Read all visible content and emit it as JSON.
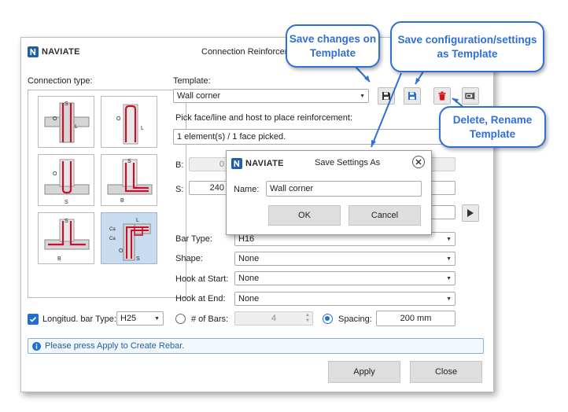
{
  "dialog": {
    "brand": "NAVIATE",
    "title": "Connection Reinforceme",
    "connection_type_label": "Connection type:",
    "template_label": "Template:",
    "template_value": "Wall corner",
    "pick_instruction": "Pick face/line and host to place reinforcement:",
    "pick_status": "1 element(s) / 1 face picked.",
    "b_label": "B:",
    "b_value": "0",
    "s_label": "S:",
    "s_value": "240",
    "bar_type_label": "Bar Type:",
    "bar_type_value": "H16",
    "shape_label": "Shape:",
    "shape_value": "None",
    "hook_start_label": "Hook at Start:",
    "hook_start_value": "None",
    "hook_end_label": "Hook at End:",
    "hook_end_value": "None",
    "long_bar_label": "Longitud. bar Type:",
    "long_bar_value": "H25",
    "long_bar_checked": true,
    "num_bars_label": "# of Bars:",
    "num_bars_value": "4",
    "spacing_label": "Spacing:",
    "spacing_value": "200 mm",
    "info_message": "Please press Apply to Create Rebar.",
    "apply_label": "Apply",
    "close_label": "Close"
  },
  "tiles": [
    {
      "name": "t-junction-straight",
      "labels": [
        "S",
        "O",
        "L"
      ]
    },
    {
      "name": "u-bar-top",
      "labels": [
        "O",
        "L"
      ]
    },
    {
      "name": "u-bar-bottom",
      "labels": [
        "O",
        "S"
      ]
    },
    {
      "name": "l-bar-corner",
      "labels": [
        "S",
        "B"
      ]
    },
    {
      "name": "t-junction-bottom",
      "labels": [
        "S",
        "B"
      ]
    },
    {
      "name": "wall-corner",
      "labels": [
        "L",
        "Ca",
        "Ca",
        "O",
        "S"
      ],
      "selected": true
    }
  ],
  "save_dialog": {
    "brand": "NAVIATE",
    "title": "Save Settings As",
    "name_label": "Name:",
    "name_value": "Wall corner",
    "ok_label": "OK",
    "cancel_label": "Cancel"
  },
  "callouts": {
    "save_changes": "Save changes on Template",
    "save_config": "Save configuration/settings as Template",
    "delete_rename": "Delete, Rename Template"
  },
  "colors": {
    "accent": "#2f6fd6",
    "rebar": "#c8102e",
    "selected_tile": "#c9dbef",
    "info_border": "#7fb3d8"
  }
}
